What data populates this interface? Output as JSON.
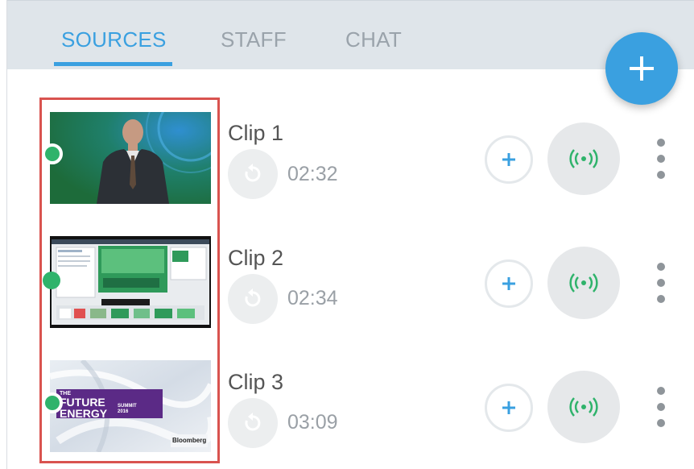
{
  "tabs": [
    {
      "label": "SOURCES",
      "active": true
    },
    {
      "label": "STAFF",
      "active": false
    },
    {
      "label": "CHAT",
      "active": false
    }
  ],
  "fab_icon": "plus-icon",
  "colors": {
    "accent": "#3aa0e0",
    "live_green": "#2fb36b",
    "selection_red": "#d9534f"
  },
  "clips": [
    {
      "name": "Clip 1",
      "duration": "02:32",
      "status": "online"
    },
    {
      "name": "Clip 2",
      "duration": "02:34",
      "status": "online"
    },
    {
      "name": "Clip 3",
      "duration": "03:09",
      "status": "online"
    }
  ],
  "thumbnail3": {
    "title_line1": "THE",
    "title_line2": "FUTURE",
    "title_line3": "ENERGY",
    "subtitle": "SUMMIT",
    "year": "2016",
    "brand": "Bloomberg"
  },
  "icons": {
    "replay": "replay-icon",
    "add": "plus-icon",
    "live": "broadcast-icon",
    "menu": "more-vert-icon"
  }
}
